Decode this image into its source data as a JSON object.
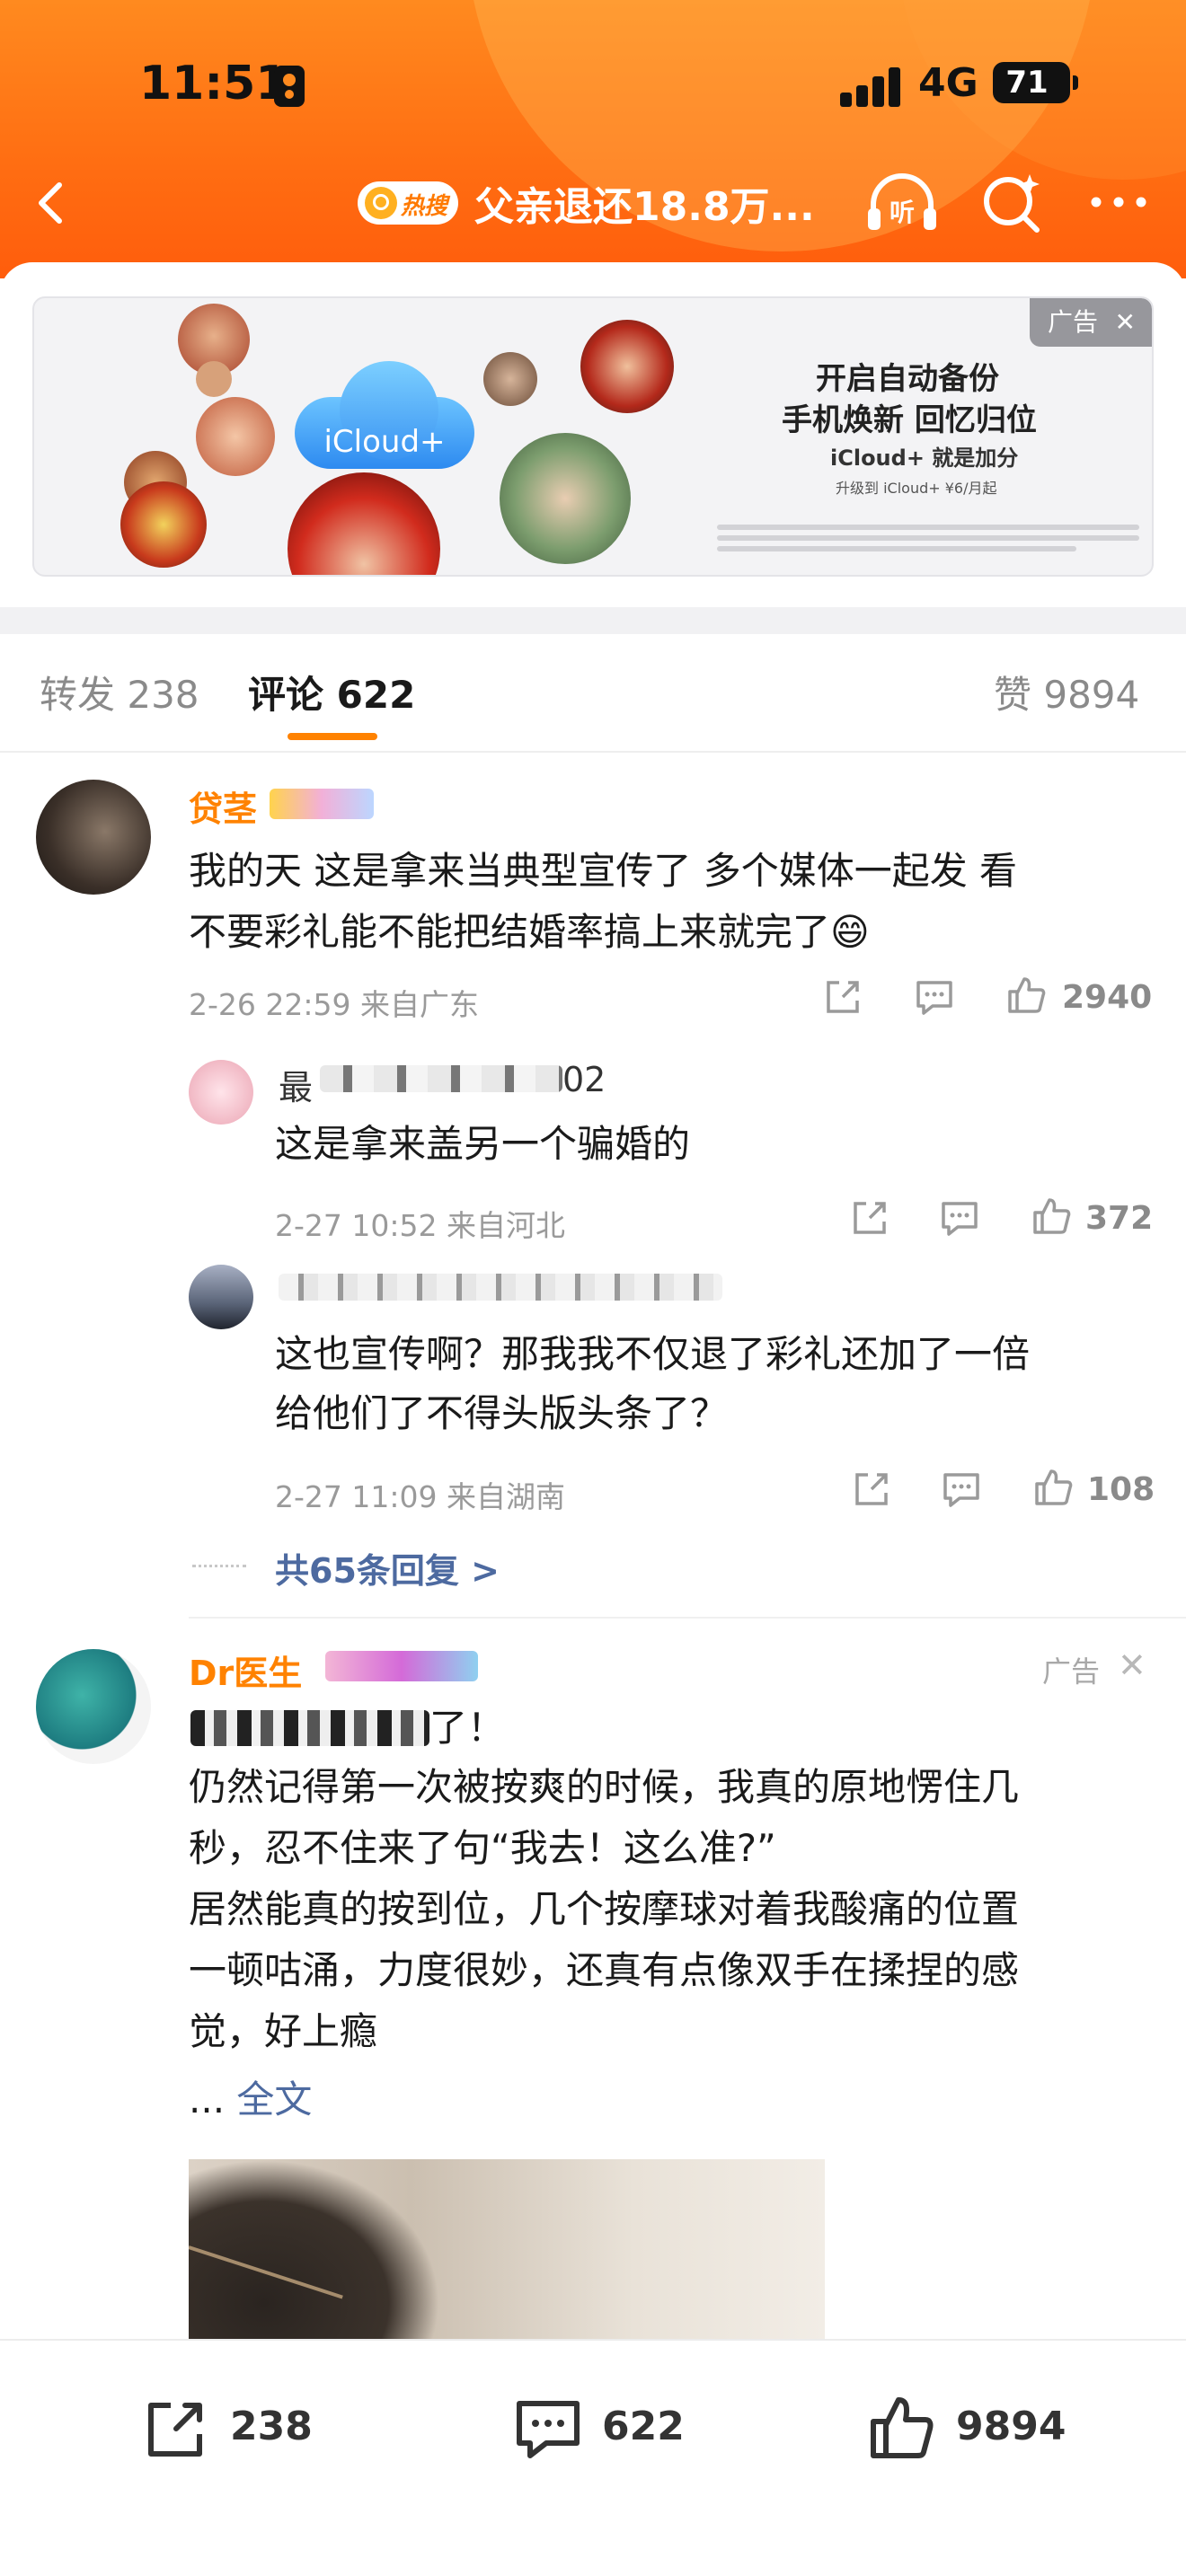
{
  "status_bar": {
    "time": "11:51",
    "network": "4G",
    "battery": "71"
  },
  "nav": {
    "hot_badge": "热搜",
    "title": "父亲退还18.8万..."
  },
  "ad_banner": {
    "tag": "广告",
    "cloud_label": "iCloud+",
    "headline_1": "开启自动备份",
    "headline_2": "手机焕新 回忆归位",
    "headline_3": "iCloud+ 就是加分",
    "headline_4": "升级到 iCloud+ ¥6/月起"
  },
  "tabs": [
    {
      "label": "转发 238",
      "active": false
    },
    {
      "label": "评论 622",
      "active": true
    },
    {
      "label": "赞 9894",
      "active": false
    }
  ],
  "comments": [
    {
      "username": "贷茎",
      "lines": [
        "我的天 这是拿来当典型宣传了 多个媒体一起发 看",
        "不要彩礼能不能把结婚率搞上来就完了😄"
      ],
      "meta": "2-26 22:59 来自广东",
      "likes": "2940",
      "replies": [
        {
          "username": "最",
          "username_suffix": "02",
          "lines": [
            "这是拿来盖另一个骗婚的"
          ],
          "meta": "2-27 10:52 来自河北",
          "likes": "372"
        },
        {
          "username": "",
          "username_suffix": "",
          "lines": [
            "这也宣传啊？那我我不仅退了彩礼还加了一倍",
            "给他们了不得头版头条了？"
          ],
          "meta": "2-27 11:09 来自湖南",
          "likes": "108"
        }
      ],
      "more_replies": "共65条回复 >"
    }
  ],
  "ad_post": {
    "username": "Dr医生",
    "tag": "广告",
    "first_line": "了！",
    "lines": [
      "仍然记得第一次被按爽的时候，我真的原地愣住几",
      "秒，忍不住来了句“我去！这么准?”",
      "居然能真的按到位，几个按摩球对着我酸痛的位置",
      "一顿咕涌，力度很妙，还真有点像双手在揉捏的感",
      "觉，好上瘾"
    ],
    "ellipsis": "... ",
    "full_text": "全文"
  },
  "bottom_bar": {
    "repost_count": "238",
    "comment_count": "622",
    "like_count": "9894"
  },
  "colors": {
    "brand_orange": "#ff8200",
    "link_blue": "#4d6aa0",
    "header_gradient_top": "#ff8a1f"
  },
  "icons": [
    "back-icon",
    "listen-icon",
    "search-icon",
    "more-icon",
    "share-icon",
    "comment-icon",
    "like-icon",
    "close-icon"
  ]
}
